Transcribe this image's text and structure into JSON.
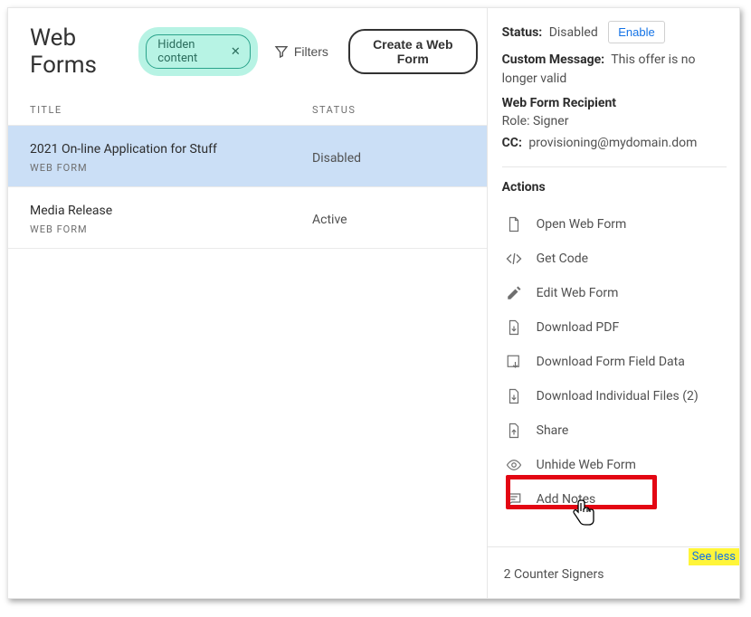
{
  "header": {
    "title": "Web Forms",
    "chip_label": "Hidden content",
    "filters_label": "Filters",
    "create_label": "Create a Web Form"
  },
  "columns": {
    "title": "TITLE",
    "status": "STATUS"
  },
  "rows": [
    {
      "title": "2021 On-line Application for Stuff",
      "subtype": "WEB FORM",
      "status": "Disabled",
      "selected": true
    },
    {
      "title": "Media Release",
      "subtype": "WEB FORM",
      "status": "Active",
      "selected": false
    }
  ],
  "details": {
    "status_label": "Status:",
    "status_value": "Disabled",
    "enable_label": "Enable",
    "custom_message_label": "Custom Message:",
    "custom_message_value": "This offer is no longer valid",
    "recipient_heading": "Web Form Recipient",
    "role_label": "Role:",
    "role_value": "Signer",
    "cc_label": "CC:",
    "cc_value": "provisioning@mydomain.dom"
  },
  "actions": {
    "heading": "Actions",
    "items": {
      "open": "Open Web Form",
      "get_code": "Get Code",
      "edit": "Edit Web Form",
      "pdf": "Download PDF",
      "form_data": "Download Form Field Data",
      "individual": "Download Individual Files (2)",
      "share": "Share",
      "unhide": "Unhide Web Form",
      "notes": "Add Notes"
    },
    "see_less": "See less"
  },
  "footer": {
    "counter_signers": "2 Counter Signers"
  }
}
